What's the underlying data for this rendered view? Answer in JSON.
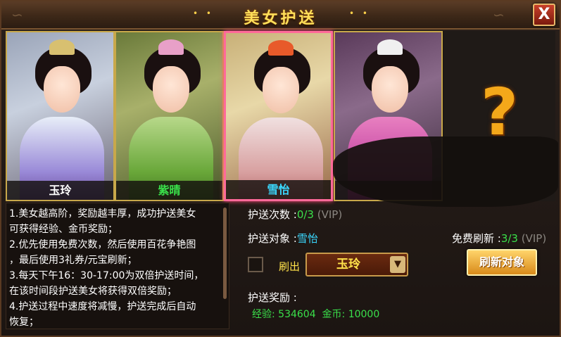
{
  "window": {
    "title": "美女护送",
    "title_ornament": "• •",
    "close_label": "X"
  },
  "portraits": [
    {
      "name": "玉玲",
      "name_color": "#ffffff",
      "selected": false
    },
    {
      "name": "紫晴",
      "name_color": "#3ae04a",
      "selected": false
    },
    {
      "name": "雪怡",
      "name_color": "#3ad8ff",
      "selected": true
    },
    {
      "name": "",
      "name_color": "#c040c0",
      "selected": false
    },
    {
      "name": "?",
      "name_color": "#f4a81a",
      "selected": false
    }
  ],
  "description": {
    "lines": [
      "1.美女越高阶，奖励越丰厚，成功护送美女",
      "可获得经验、金币奖励；",
      "2.优先使用免费次数，然后使用百花争艳图",
      "，最后使用3礼券/元宝刷新；",
      "3.每天下午16：30-17:00为双倍护送时间，",
      "在该时间段护送美女将获得双倍奖励；",
      "4.护送过程中速度将减慢，护送完成后自动",
      "恢复；"
    ]
  },
  "escort": {
    "count_label": "护送次数 :",
    "count_value": "0/3",
    "count_vip": "(VIP)",
    "target_label": "护送对象 :",
    "target_value": "雪怡",
    "free_refresh_label": "免费刷新 :",
    "free_refresh_value": "3/3",
    "free_refresh_vip": "(VIP)",
    "brush_label": "刷出",
    "brush_select": "玉玲",
    "refresh_button": "刷新对象",
    "reward_label": "护送奖励 :",
    "exp_label": "经验:",
    "exp_value": "534604",
    "gold_label": "金币:",
    "gold_value": "10000"
  },
  "colors": {
    "title": "#ffe05a",
    "accent_green": "#3ae04a",
    "accent_cyan": "#3ad8ff",
    "button_gold": "#d88a1a",
    "frame_gold": "#c8a84a",
    "selected_pink": "#ff6a9a"
  }
}
